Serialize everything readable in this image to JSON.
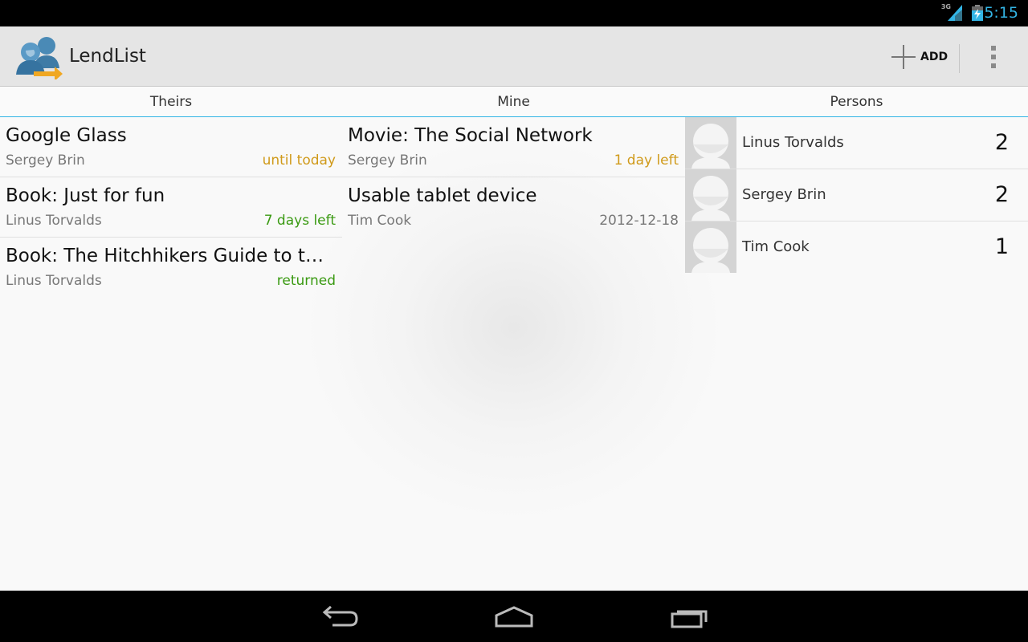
{
  "status_bar": {
    "network": "3G",
    "time": "5:15"
  },
  "app": {
    "title": "LendList",
    "add_label": "ADD"
  },
  "tabs": [
    "Theirs",
    "Mine",
    "Persons"
  ],
  "theirs": [
    {
      "title": "Google Glass",
      "person": "Sergey Brin",
      "status": "until today",
      "status_color": "#d09a1a"
    },
    {
      "title": "Book: Just for fun",
      "person": "Linus Torvalds",
      "status": "7 days left",
      "status_color": "#3a9a12"
    },
    {
      "title": "Book: The Hitchhikers Guide to the…",
      "person": "Linus Torvalds",
      "status": "returned",
      "status_color": "#3a9a12"
    }
  ],
  "mine": [
    {
      "title": "Movie: The Social Network",
      "person": "Sergey Brin",
      "status": "1 day left",
      "status_color": "#d09a1a"
    },
    {
      "title": "Usable tablet device",
      "person": "Tim Cook",
      "status": "2012-12-18",
      "status_color": "#777777"
    }
  ],
  "persons": [
    {
      "name": "Linus Torvalds",
      "count": "2"
    },
    {
      "name": "Sergey Brin",
      "count": "2"
    },
    {
      "name": "Tim Cook",
      "count": "1"
    }
  ],
  "colors": {
    "accent": "#33b5e5",
    "orange": "#d09a1a",
    "green": "#3a9a12"
  },
  "icons": {
    "app": "lendlist-users-arrow-icon",
    "add": "plus-icon",
    "overflow": "overflow-menu-icon",
    "back": "back-icon",
    "home": "home-icon",
    "recents": "recent-apps-icon",
    "avatar": "default-contact-icon"
  }
}
